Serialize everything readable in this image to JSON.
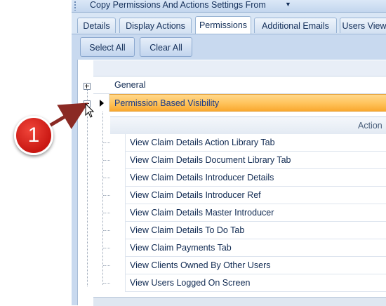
{
  "toolbar_top": {
    "label": "Copy Permissions And Actions Settings From",
    "arrow": "▼"
  },
  "tabs": [
    {
      "label": "Details",
      "active": false
    },
    {
      "label": "Display Actions",
      "active": false
    },
    {
      "label": "Permissions",
      "active": true
    },
    {
      "label": "Additional Emails",
      "active": false
    },
    {
      "label": "Users View",
      "active": false
    }
  ],
  "buttons": {
    "select_all": "Select All",
    "clear_all": "Clear All"
  },
  "groups": {
    "general": "General",
    "permission_based": "Permission Based Visibility"
  },
  "child_header": "Action",
  "child_rows": [
    "View Claim Details Action Library Tab",
    "View Claim Details Document Library Tab",
    "View Claim Details Introducer Details",
    "View Claim Details Introducer Ref",
    "View Claim Details Master Introducer",
    "View Claim Details To Do Tab",
    "View Claim Payments Tab",
    "View Clients Owned By Other Users",
    "View Users Logged On Screen"
  ],
  "annotation": {
    "step": "1"
  },
  "colors": {
    "selected_row": "#ffc25a",
    "badge": "#d91e18",
    "tab_strip": "#d9e6f5"
  }
}
